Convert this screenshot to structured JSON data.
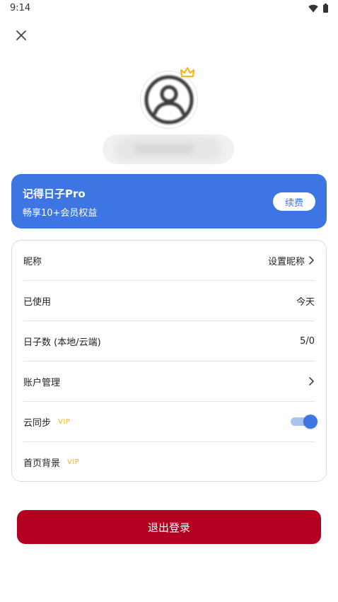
{
  "status_bar": {
    "time": "9:14",
    "icons": [
      "wifi-icon",
      "battery-icon"
    ]
  },
  "header": {
    "close_icon": "close-icon"
  },
  "profile": {
    "avatar_icon": "user-circle-icon",
    "badge_icon": "crown-icon",
    "nickname": ""
  },
  "pro_card": {
    "title": "记得日子Pro",
    "subtitle": "畅享10+会员权益",
    "renew_label": "续费",
    "color": "#3d75e3"
  },
  "settings": {
    "nickname": {
      "label": "昵称",
      "value": "设置昵称"
    },
    "used": {
      "label": "已使用",
      "value": "今天"
    },
    "days_count": {
      "label": "日子数 (本地/云端)",
      "value": "5/0"
    },
    "account": {
      "label": "账户管理"
    },
    "cloud_sync": {
      "label": "云同步",
      "badge": "VIP",
      "enabled": true
    },
    "home_background": {
      "label": "首页背景",
      "badge": "VIP"
    }
  },
  "logout": {
    "label": "退出登录",
    "color": "#b30020"
  }
}
